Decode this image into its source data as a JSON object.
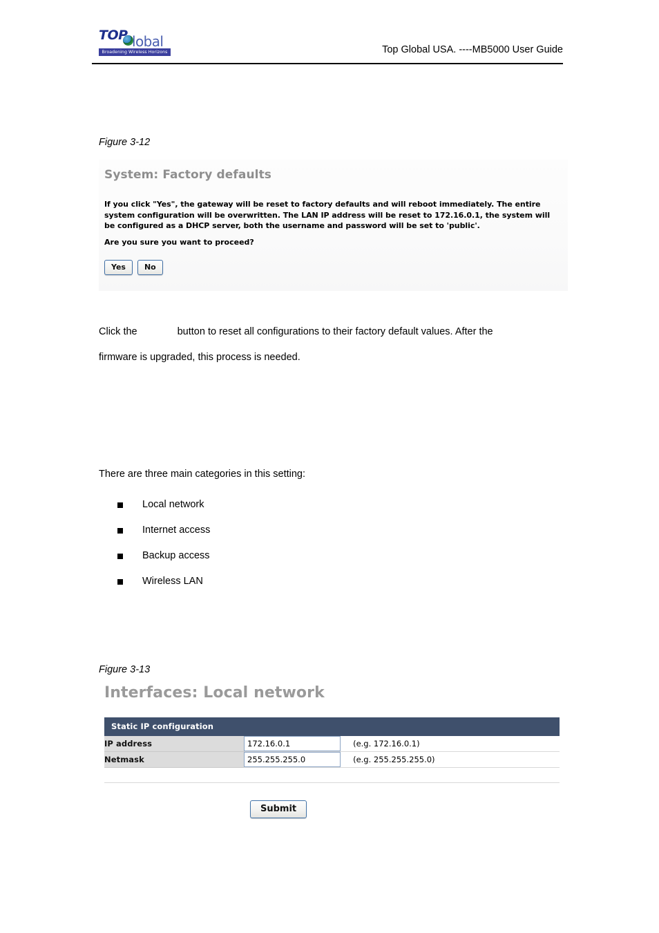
{
  "header": {
    "logo": {
      "top_text": "TOP",
      "global_text": "lobal",
      "globe_letter": "G",
      "tagline": "Broadening Wireless Horizons"
    },
    "document_title": "Top Global USA. ----MB5000 User Guide"
  },
  "figure_3_12": {
    "caption": "Figure 3-12",
    "panel": {
      "heading": "System: Factory defaults",
      "warning": "If you click \"Yes\", the gateway will be reset to factory defaults and will reboot immediately. The entire system configuration will be overwritten. The LAN IP address will be reset to 172.16.0.1, the system will be configured as a DHCP server, both the username and password will be set to 'public'.",
      "question": "Are you sure you want to proceed?",
      "buttons": [
        {
          "label": "Yes"
        },
        {
          "label": "No"
        }
      ]
    }
  },
  "body_text": {
    "paragraph_1_before": "Click the",
    "paragraph_1_after": "button to reset all configurations to their factory default values. After the",
    "paragraph_1_line2": "firmware is upgraded, this process is needed.",
    "categories_intro": "There are three main categories in this setting:"
  },
  "categories": [
    {
      "label": "Local network"
    },
    {
      "label": "Internet access"
    },
    {
      "label": "Backup access"
    },
    {
      "label": "Wireless LAN"
    }
  ],
  "figure_3_13": {
    "caption": "Figure 3-13",
    "panel": {
      "heading": "Interfaces: Local network",
      "table": {
        "section_title": "Static IP configuration",
        "rows": [
          {
            "label": "IP address",
            "value": "172.16.0.1",
            "placeholder": "172.16.0.1",
            "hint": "(e.g. 172.16.0.1)"
          },
          {
            "label": "Netmask",
            "value": "255.255.255.0",
            "placeholder": "255.255.255.0",
            "hint": "(e.g. 255.255.255.0)"
          }
        ]
      },
      "submit_label": "Submit"
    }
  },
  "colors": {
    "table_header": "#3f506c",
    "label_cell": "#dcdcdc",
    "button_border": "#3f6ea5",
    "heading_gray": "#8e8e8e",
    "logo_blue": "#1d2f8c",
    "logo_banner": "#3b3f9e"
  }
}
